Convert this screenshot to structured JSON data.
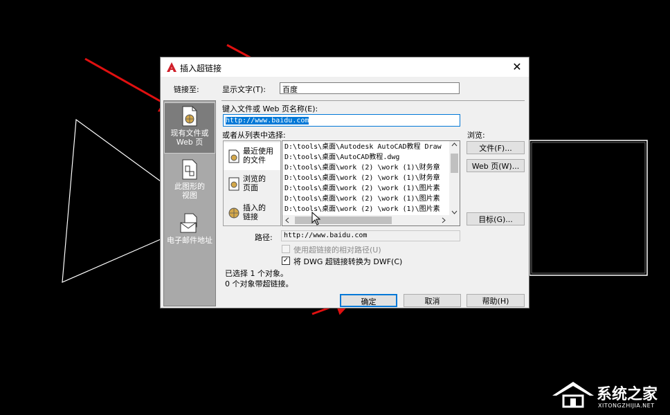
{
  "dialog": {
    "title": "插入超链接",
    "close_glyph": "✕",
    "link_to_label": "链接至:",
    "display_text_label": "显示文字(T):",
    "display_text_value": "百度",
    "type_file_label": "键入文件或 Web 页名称(E):",
    "url_value": "http://www.baidu.com",
    "select_from_list_label": "或者从列表中选择:",
    "browse_label": "浏览:",
    "browse_file_button": "文件(F)...",
    "browse_web_button": "Web 页(W)...",
    "target_button": "目标(G)...",
    "path_label": "路径:",
    "path_value": "http://www.baidu.com",
    "relative_path_label": "使用超链接的相对路径(U)",
    "convert_dwg_label": "将 DWG 超链接转换为 DWF(C)",
    "convert_dwg_checked": "✓",
    "status_line_1": "已选择 1 个对象。",
    "status_line_2": "0 个对象带超链接。",
    "ok_button": "确定",
    "cancel_button": "取消",
    "help_button": "帮助(H)"
  },
  "link_to": {
    "existing_line_1": "现有文件或",
    "existing_line_2": "Web 页",
    "view_line_1": "此图形的",
    "view_line_2": "视图",
    "email": "电子邮件地址"
  },
  "list_sidebar": {
    "recent_line_1": "最近使用",
    "recent_line_2": "的文件",
    "browsed_line_1": "浏览的",
    "browsed_line_2": "页面",
    "inserted_line_1": "插入的",
    "inserted_line_2": "链接"
  },
  "file_list": [
    "D:\\tools\\桌面\\Autodesk AutoCAD教程 Draw",
    "D:\\tools\\桌面\\AutoCAD教程.dwg",
    "D:\\tools\\桌面\\work (2) \\work (1)\\财务章",
    "D:\\tools\\桌面\\work (2) \\work (1)\\财务章",
    "D:\\tools\\桌面\\work (2) \\work (1)\\图片素",
    "D:\\tools\\桌面\\work (2) \\work (1)\\图片素",
    "D:\\tools\\桌面\\work (2) \\work (1)\\图片素"
  ],
  "watermark": {
    "name": "系统之家",
    "url": "XITONGZHIJIA.NET"
  },
  "colors": {
    "arrow": "#e01010",
    "url_highlight": "#0078d7",
    "ok_border": "#0078d7"
  }
}
